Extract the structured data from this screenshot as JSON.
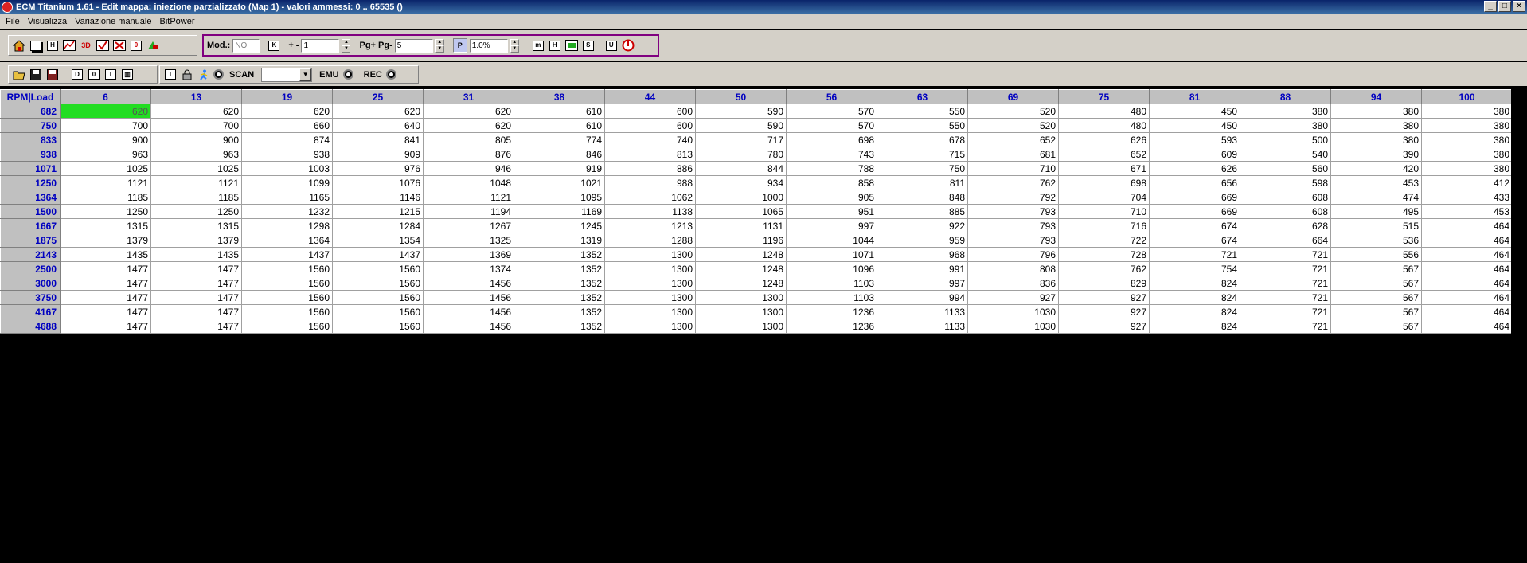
{
  "window": {
    "title": "ECM Titanium 1.61 - Edit mappa: iniezione parzializzato (Map 1) - valori ammessi: 0 .. 65535 ()",
    "controls": [
      "_",
      "□",
      "×"
    ]
  },
  "menu": [
    "File",
    "Visualizza",
    "Variazione manuale",
    "BitPower"
  ],
  "toolbar1": {
    "mod_label": "Mod.:",
    "mod_value": "NO",
    "k_label": "K",
    "plusminus_label": "+ -",
    "step_value": "1",
    "pg_label": "Pg+ Pg-",
    "pg_value": "5",
    "p_label": "P",
    "percent_value": "1.0%"
  },
  "toolbar2": {
    "scan_label": "SCAN",
    "scan_value": "",
    "emu_label": "EMU",
    "rec_label": "REC"
  },
  "table": {
    "corner": "RPM|Load",
    "columns": [
      "6",
      "13",
      "19",
      "25",
      "31",
      "38",
      "44",
      "50",
      "56",
      "63",
      "69",
      "75",
      "81",
      "88",
      "94",
      "100"
    ],
    "rows": [
      {
        "rpm": "682",
        "values": [
          "620",
          "620",
          "620",
          "620",
          "620",
          "610",
          "600",
          "590",
          "570",
          "550",
          "520",
          "480",
          "450",
          "380",
          "380",
          "380"
        ]
      },
      {
        "rpm": "750",
        "values": [
          "700",
          "700",
          "660",
          "640",
          "620",
          "610",
          "600",
          "590",
          "570",
          "550",
          "520",
          "480",
          "450",
          "380",
          "380",
          "380"
        ]
      },
      {
        "rpm": "833",
        "values": [
          "900",
          "900",
          "874",
          "841",
          "805",
          "774",
          "740",
          "717",
          "698",
          "678",
          "652",
          "626",
          "593",
          "500",
          "380",
          "380"
        ]
      },
      {
        "rpm": "938",
        "values": [
          "963",
          "963",
          "938",
          "909",
          "876",
          "846",
          "813",
          "780",
          "743",
          "715",
          "681",
          "652",
          "609",
          "540",
          "390",
          "380"
        ]
      },
      {
        "rpm": "1071",
        "values": [
          "1025",
          "1025",
          "1003",
          "976",
          "946",
          "919",
          "886",
          "844",
          "788",
          "750",
          "710",
          "671",
          "626",
          "560",
          "420",
          "380"
        ]
      },
      {
        "rpm": "1250",
        "values": [
          "1121",
          "1121",
          "1099",
          "1076",
          "1048",
          "1021",
          "988",
          "934",
          "858",
          "811",
          "762",
          "698",
          "656",
          "598",
          "453",
          "412"
        ]
      },
      {
        "rpm": "1364",
        "values": [
          "1185",
          "1185",
          "1165",
          "1146",
          "1121",
          "1095",
          "1062",
          "1000",
          "905",
          "848",
          "792",
          "704",
          "669",
          "608",
          "474",
          "433"
        ]
      },
      {
        "rpm": "1500",
        "values": [
          "1250",
          "1250",
          "1232",
          "1215",
          "1194",
          "1169",
          "1138",
          "1065",
          "951",
          "885",
          "793",
          "710",
          "669",
          "608",
          "495",
          "453"
        ]
      },
      {
        "rpm": "1667",
        "values": [
          "1315",
          "1315",
          "1298",
          "1284",
          "1267",
          "1245",
          "1213",
          "1131",
          "997",
          "922",
          "793",
          "716",
          "674",
          "628",
          "515",
          "464"
        ]
      },
      {
        "rpm": "1875",
        "values": [
          "1379",
          "1379",
          "1364",
          "1354",
          "1325",
          "1319",
          "1288",
          "1196",
          "1044",
          "959",
          "793",
          "722",
          "674",
          "664",
          "536",
          "464"
        ]
      },
      {
        "rpm": "2143",
        "values": [
          "1435",
          "1435",
          "1437",
          "1437",
          "1369",
          "1352",
          "1300",
          "1248",
          "1071",
          "968",
          "796",
          "728",
          "721",
          "721",
          "556",
          "464"
        ]
      },
      {
        "rpm": "2500",
        "values": [
          "1477",
          "1477",
          "1560",
          "1560",
          "1374",
          "1352",
          "1300",
          "1248",
          "1096",
          "991",
          "808",
          "762",
          "754",
          "721",
          "567",
          "464"
        ]
      },
      {
        "rpm": "3000",
        "values": [
          "1477",
          "1477",
          "1560",
          "1560",
          "1456",
          "1352",
          "1300",
          "1248",
          "1103",
          "997",
          "836",
          "829",
          "824",
          "721",
          "567",
          "464"
        ]
      },
      {
        "rpm": "3750",
        "values": [
          "1477",
          "1477",
          "1560",
          "1560",
          "1456",
          "1352",
          "1300",
          "1300",
          "1103",
          "994",
          "927",
          "927",
          "824",
          "721",
          "567",
          "464"
        ]
      },
      {
        "rpm": "4167",
        "values": [
          "1477",
          "1477",
          "1560",
          "1560",
          "1456",
          "1352",
          "1300",
          "1300",
          "1236",
          "1133",
          "1030",
          "927",
          "824",
          "721",
          "567",
          "464"
        ]
      },
      {
        "rpm": "4688",
        "values": [
          "1477",
          "1477",
          "1560",
          "1560",
          "1456",
          "1352",
          "1300",
          "1300",
          "1236",
          "1133",
          "1030",
          "927",
          "824",
          "721",
          "567",
          "464"
        ]
      }
    ]
  },
  "colors": {
    "selected_cell": "#22dd22",
    "header_text": "#0000c0",
    "toolbar_bg": "#d4d0c8",
    "group_border": "#800080"
  }
}
